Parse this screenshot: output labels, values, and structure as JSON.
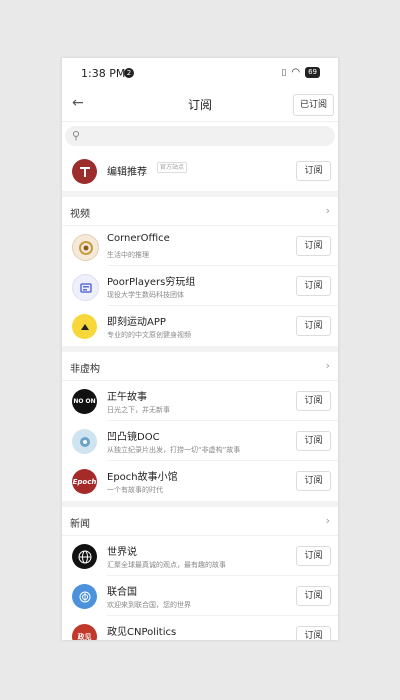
{
  "status": {
    "time": "1:38 PM",
    "notif_badge": "2",
    "battery": "69"
  },
  "header": {
    "title": "订阅",
    "subscribed_label": "已订阅"
  },
  "search": {
    "placeholder": ""
  },
  "featured": {
    "name": "编辑推荐",
    "tag": "官方站点",
    "subscribe": "订阅"
  },
  "sections": [
    {
      "title": "视频",
      "items": [
        {
          "name": "CornerOffice",
          "desc": "生活中的推理",
          "subscribe": "订阅"
        },
        {
          "name": "PoorPlayers穷玩组",
          "desc": "现役大学生数码科技团体",
          "subscribe": "订阅"
        },
        {
          "name": "即刻运动APP",
          "desc": "专业的的中文原创健身视频",
          "subscribe": "订阅"
        }
      ]
    },
    {
      "title": "非虚构",
      "items": [
        {
          "name": "正午故事",
          "desc": "日光之下，并无新事",
          "subscribe": "订阅"
        },
        {
          "name": "凹凸镜DOC",
          "desc": "从独立纪录片出发，打捞一切“非虚构”故事",
          "subscribe": "订阅"
        },
        {
          "name": "Epoch故事小馆",
          "desc": "一个有故事的时代",
          "subscribe": "订阅"
        }
      ]
    },
    {
      "title": "新闻",
      "items": [
        {
          "name": "世界说",
          "desc": "汇聚全球最真诚的观点，最有趣的故事",
          "subscribe": "订阅"
        },
        {
          "name": "联合国",
          "desc": "欢迎来到联合国，您的世界",
          "subscribe": "订阅"
        },
        {
          "name": "政见CNPolitics",
          "desc": "",
          "subscribe": "订阅"
        }
      ]
    }
  ],
  "avatar_text": {
    "noon": "NO ON",
    "epoch": "Epoch",
    "politics": "政见"
  },
  "colors": {
    "background": "#e9e9e9",
    "surface": "#ffffff",
    "featured_avatar": "#9b2d2d"
  }
}
